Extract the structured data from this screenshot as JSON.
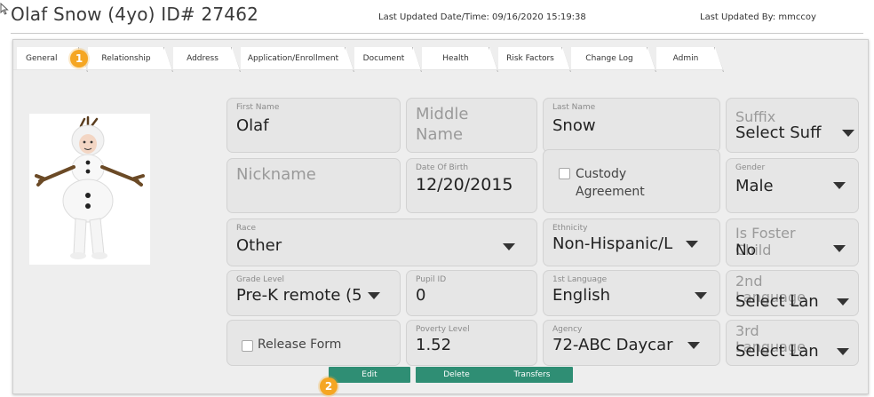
{
  "header": {
    "title": "Olaf Snow (4yo) ID# 27462",
    "last_updated": "Last Updated Date/Time: 09/16/2020 15:19:38",
    "updated_by": "Last Updated By: mmccoy"
  },
  "tabs": [
    {
      "label": "General"
    },
    {
      "label": "Relationship"
    },
    {
      "label": "Address"
    },
    {
      "label": "Application/Enrollment"
    },
    {
      "label": "Document"
    },
    {
      "label": "Health"
    },
    {
      "label": "Risk Factors"
    },
    {
      "label": "Change Log"
    },
    {
      "label": "Admin"
    }
  ],
  "badges": {
    "one": "1",
    "two": "2"
  },
  "form": {
    "first_name": {
      "label": "First Name",
      "value": "Olaf"
    },
    "middle_name": {
      "placeholder": "Middle Name"
    },
    "last_name": {
      "label": "Last Name",
      "value": "Snow"
    },
    "suffix": {
      "placeholder": "Suffix",
      "value": "Select Suff"
    },
    "nickname": {
      "placeholder": "Nickname"
    },
    "dob": {
      "label": "Date Of Birth",
      "value": "12/20/2015"
    },
    "custody": {
      "label": "Custody Agreement"
    },
    "gender": {
      "label": "Gender",
      "value": "Male"
    },
    "race": {
      "label": "Race",
      "value": "Other"
    },
    "ethnicity": {
      "label": "Ethnicity",
      "value": "Non-Hispanic/L"
    },
    "foster": {
      "placeholder": "Is Foster Child",
      "value": "No"
    },
    "grade": {
      "label": "Grade Level",
      "value": "Pre-K remote (5"
    },
    "pupil": {
      "label": "Pupil ID",
      "value": "0"
    },
    "first_language": {
      "label": "1st Language",
      "value": "English"
    },
    "second_language": {
      "placeholder": "2nd Language",
      "value": "Select Lan"
    },
    "release": {
      "label": "Release Form"
    },
    "poverty": {
      "label": "Poverty Level",
      "value": "1.52"
    },
    "agency": {
      "label": "Agency",
      "value": "72-ABC Daycar"
    },
    "third_language": {
      "placeholder": "3rd Language",
      "value": "Select Lan"
    }
  },
  "buttons": {
    "edit": "Edit",
    "delete": "Delete",
    "transfers": "Transfers"
  },
  "colors": {
    "accent": "#2f8e74",
    "badge": "#f5a623"
  }
}
